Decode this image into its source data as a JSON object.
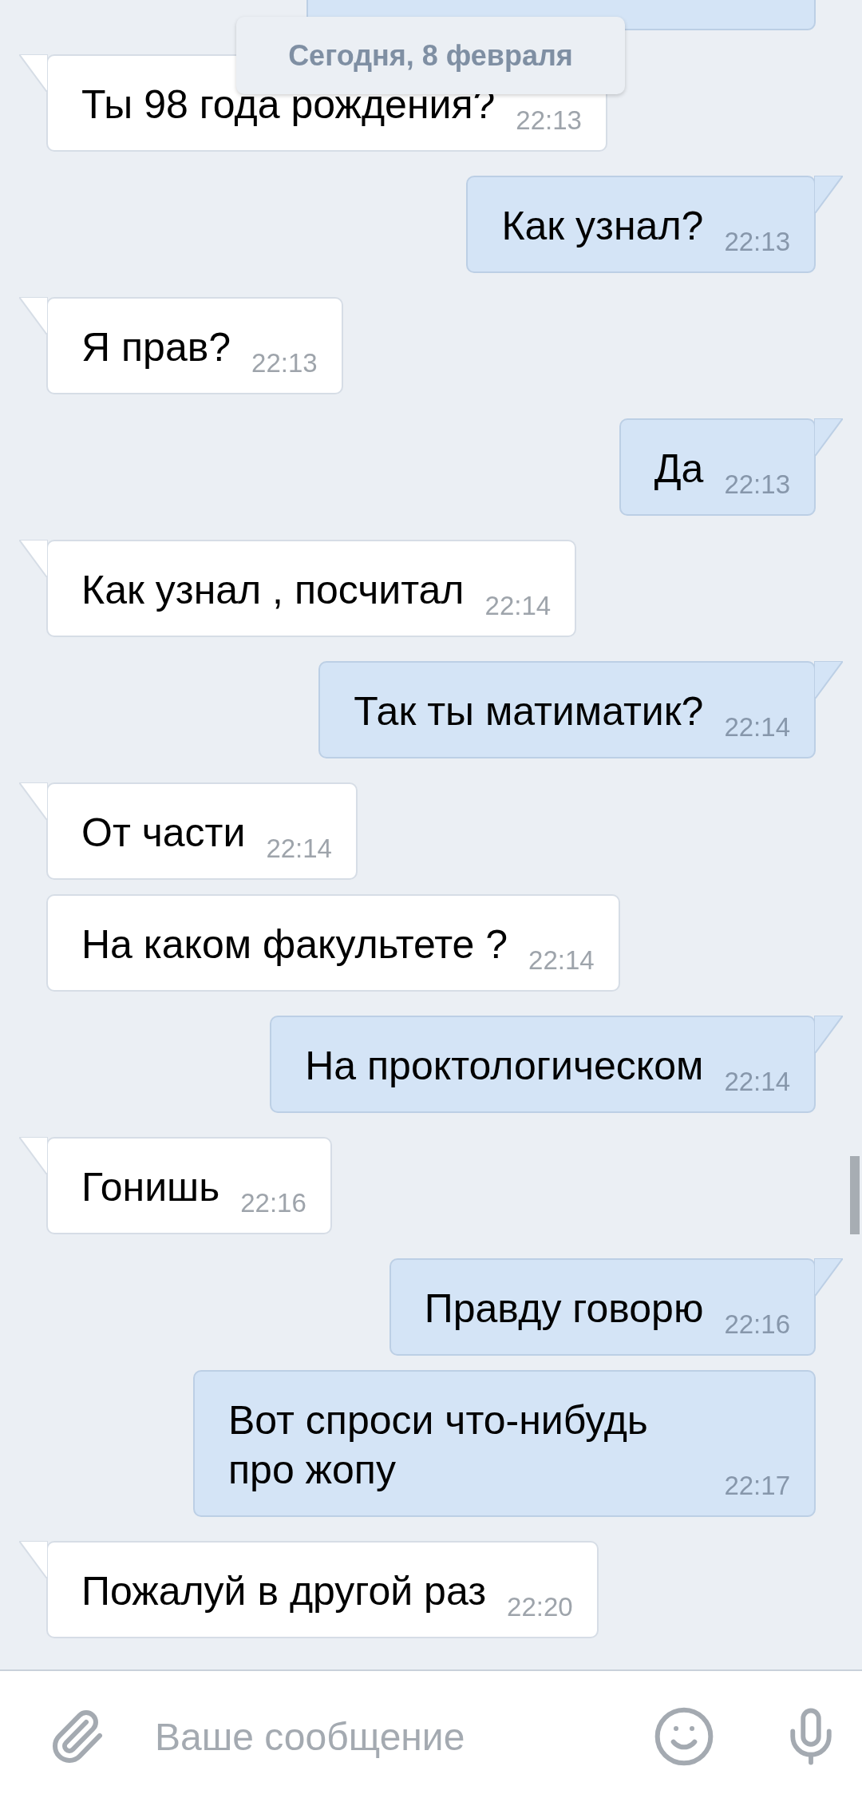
{
  "date_label": "Сегодня, 8 февраля",
  "messages": [
    {
      "outgoing": false,
      "tail": true,
      "text": "Ты 98 года рождения?",
      "time": "22:13"
    },
    {
      "outgoing": true,
      "tail": true,
      "text": "Как узнал?",
      "time": "22:13"
    },
    {
      "outgoing": false,
      "tail": true,
      "text": "Я прав?",
      "time": "22:13"
    },
    {
      "outgoing": true,
      "tail": true,
      "text": "Да",
      "time": "22:13"
    },
    {
      "outgoing": false,
      "tail": true,
      "text": "Как узнал , посчитал",
      "time": "22:14"
    },
    {
      "outgoing": true,
      "tail": true,
      "text": "Так ты матиматик?",
      "time": "22:14"
    },
    {
      "outgoing": false,
      "tail": true,
      "text": "От части",
      "time": "22:14"
    },
    {
      "outgoing": false,
      "tail": false,
      "text": "На каком факультете ?",
      "time": "22:14"
    },
    {
      "outgoing": true,
      "tail": true,
      "text": "На проктологическом",
      "time": "22:14"
    },
    {
      "outgoing": false,
      "tail": true,
      "text": "Гонишь",
      "time": "22:16"
    },
    {
      "outgoing": true,
      "tail": true,
      "text": "Правду говорю",
      "time": "22:16"
    },
    {
      "outgoing": true,
      "tail": false,
      "text": "Вот спроси что-нибудь про жопу",
      "time": "22:17"
    },
    {
      "outgoing": false,
      "tail": true,
      "text": "Пожалуй в другой раз",
      "time": "22:20"
    }
  ],
  "composer": {
    "placeholder": "Ваше сообщение"
  }
}
